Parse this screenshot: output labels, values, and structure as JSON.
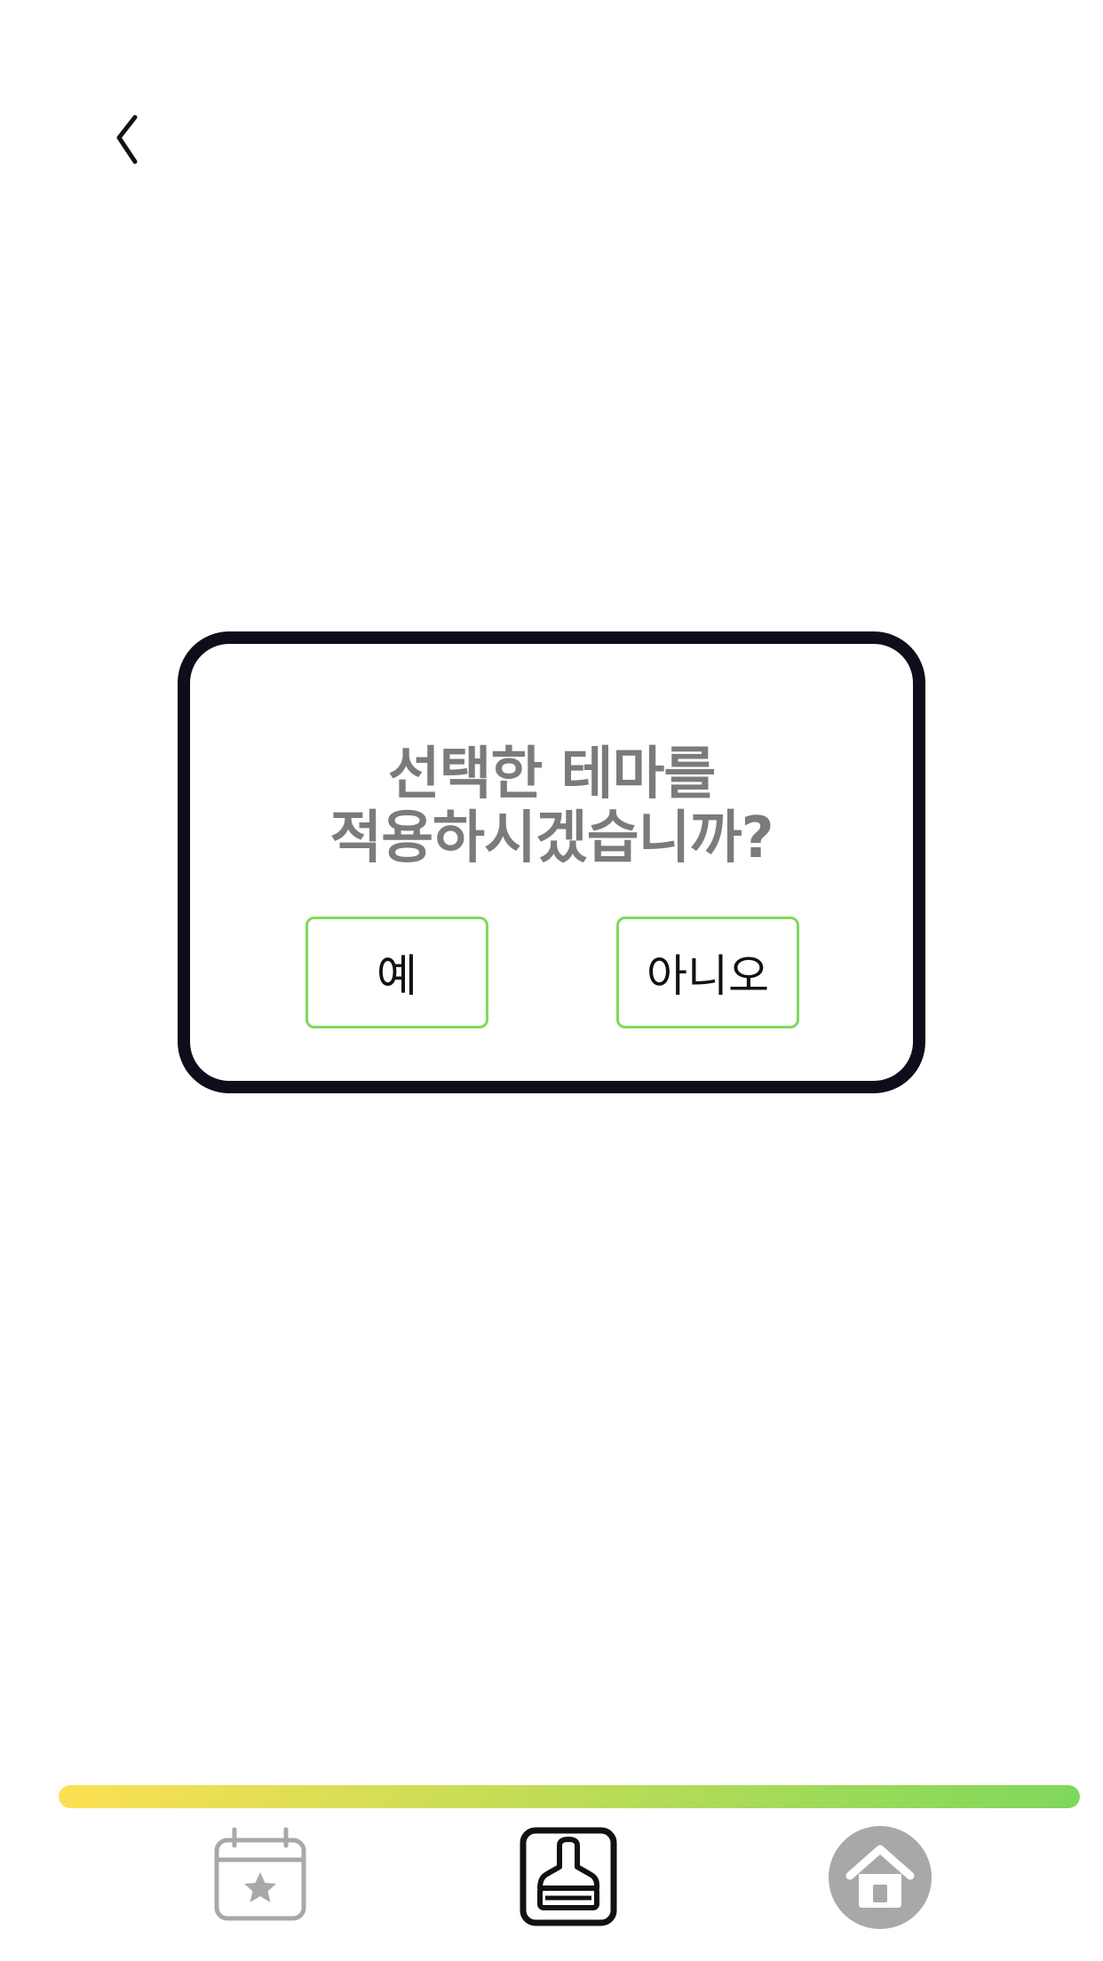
{
  "header": {
    "back_icon": "chevron-left-icon"
  },
  "dialog": {
    "message_line1": "선택한 테마를",
    "message_line2": "적용하시겠습니까?",
    "yes_label": "예",
    "no_label": "아니오",
    "border_color": "#110c1c",
    "button_border_color": "#7fd85b",
    "message_color": "#7b7b7b"
  },
  "progress_bar": {
    "gradient_start": "#fde053",
    "gradient_end": "#7fd85b"
  },
  "bottom_nav": {
    "items": [
      {
        "icon": "calendar-star-icon",
        "active": false
      },
      {
        "icon": "paint-brush-icon",
        "active": true
      },
      {
        "icon": "home-icon",
        "active": false
      }
    ],
    "inactive_color": "#a8a8a8",
    "active_color": "#111111"
  }
}
